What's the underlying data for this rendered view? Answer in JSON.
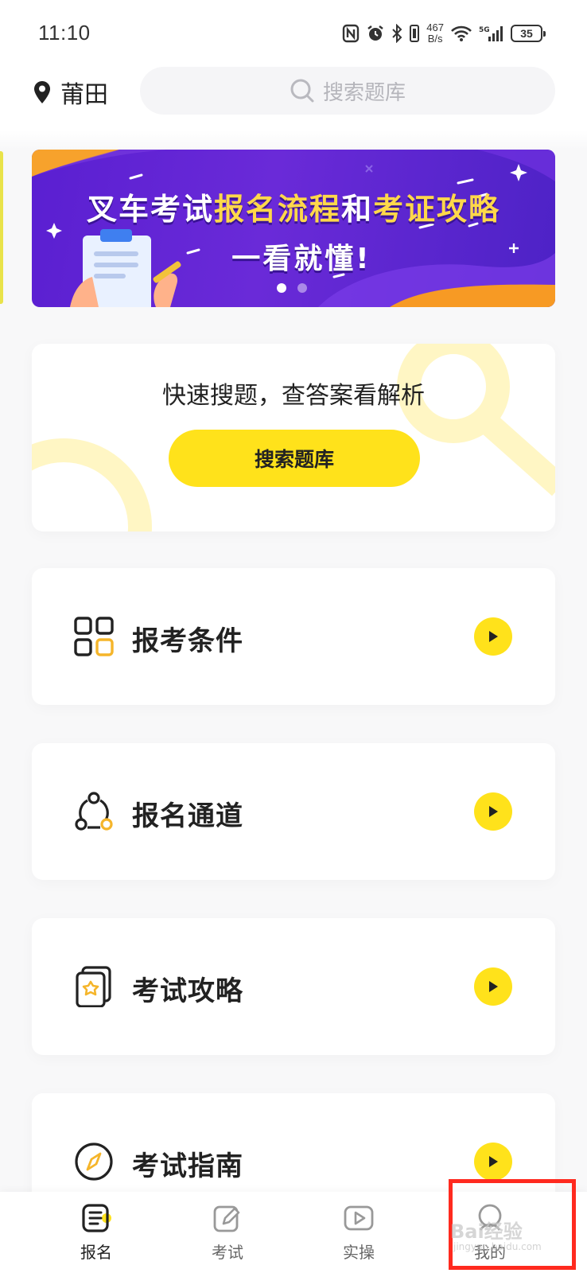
{
  "status_bar": {
    "time": "11:10",
    "net_speed_value": "467",
    "net_speed_unit": "B/s",
    "battery": "35",
    "icons": [
      "nfc-icon",
      "alarm-icon",
      "bluetooth-icon",
      "vibrate-icon",
      "wifi-icon",
      "signal-5g-icon",
      "battery-icon"
    ]
  },
  "header": {
    "location": "莆田",
    "search_placeholder": "搜索题库"
  },
  "banner": {
    "line1_a": "叉车考试",
    "line1_b": "报名流程",
    "line1_c": "和",
    "line1_d": "考证攻略",
    "line2": "一看就懂!",
    "slides_total": 2,
    "active_slide": 1
  },
  "quick_search": {
    "title": "快速搜题，查答案看解析",
    "button": "搜索题库"
  },
  "menu": [
    {
      "label": "报考条件",
      "icon": "grid-apps-icon"
    },
    {
      "label": "报名通道",
      "icon": "channel-nodes-icon"
    },
    {
      "label": "考试攻略",
      "icon": "strategy-cards-icon"
    },
    {
      "label": "考试指南",
      "icon": "compass-icon"
    }
  ],
  "bottom_nav": [
    {
      "label": "报名",
      "icon": "list-icon",
      "active": true
    },
    {
      "label": "考试",
      "icon": "edit-icon",
      "active": false
    },
    {
      "label": "实操",
      "icon": "play-icon",
      "active": false
    },
    {
      "label": "我的",
      "icon": "user-icon",
      "active": false
    }
  ],
  "watermark": "Bai经验",
  "watermark_sub": "jingyan.baidu.com",
  "colors": {
    "accent_yellow": "#ffe21b",
    "banner_purple": "#5a1fd1",
    "highlight_red": "#ff2a1f"
  }
}
